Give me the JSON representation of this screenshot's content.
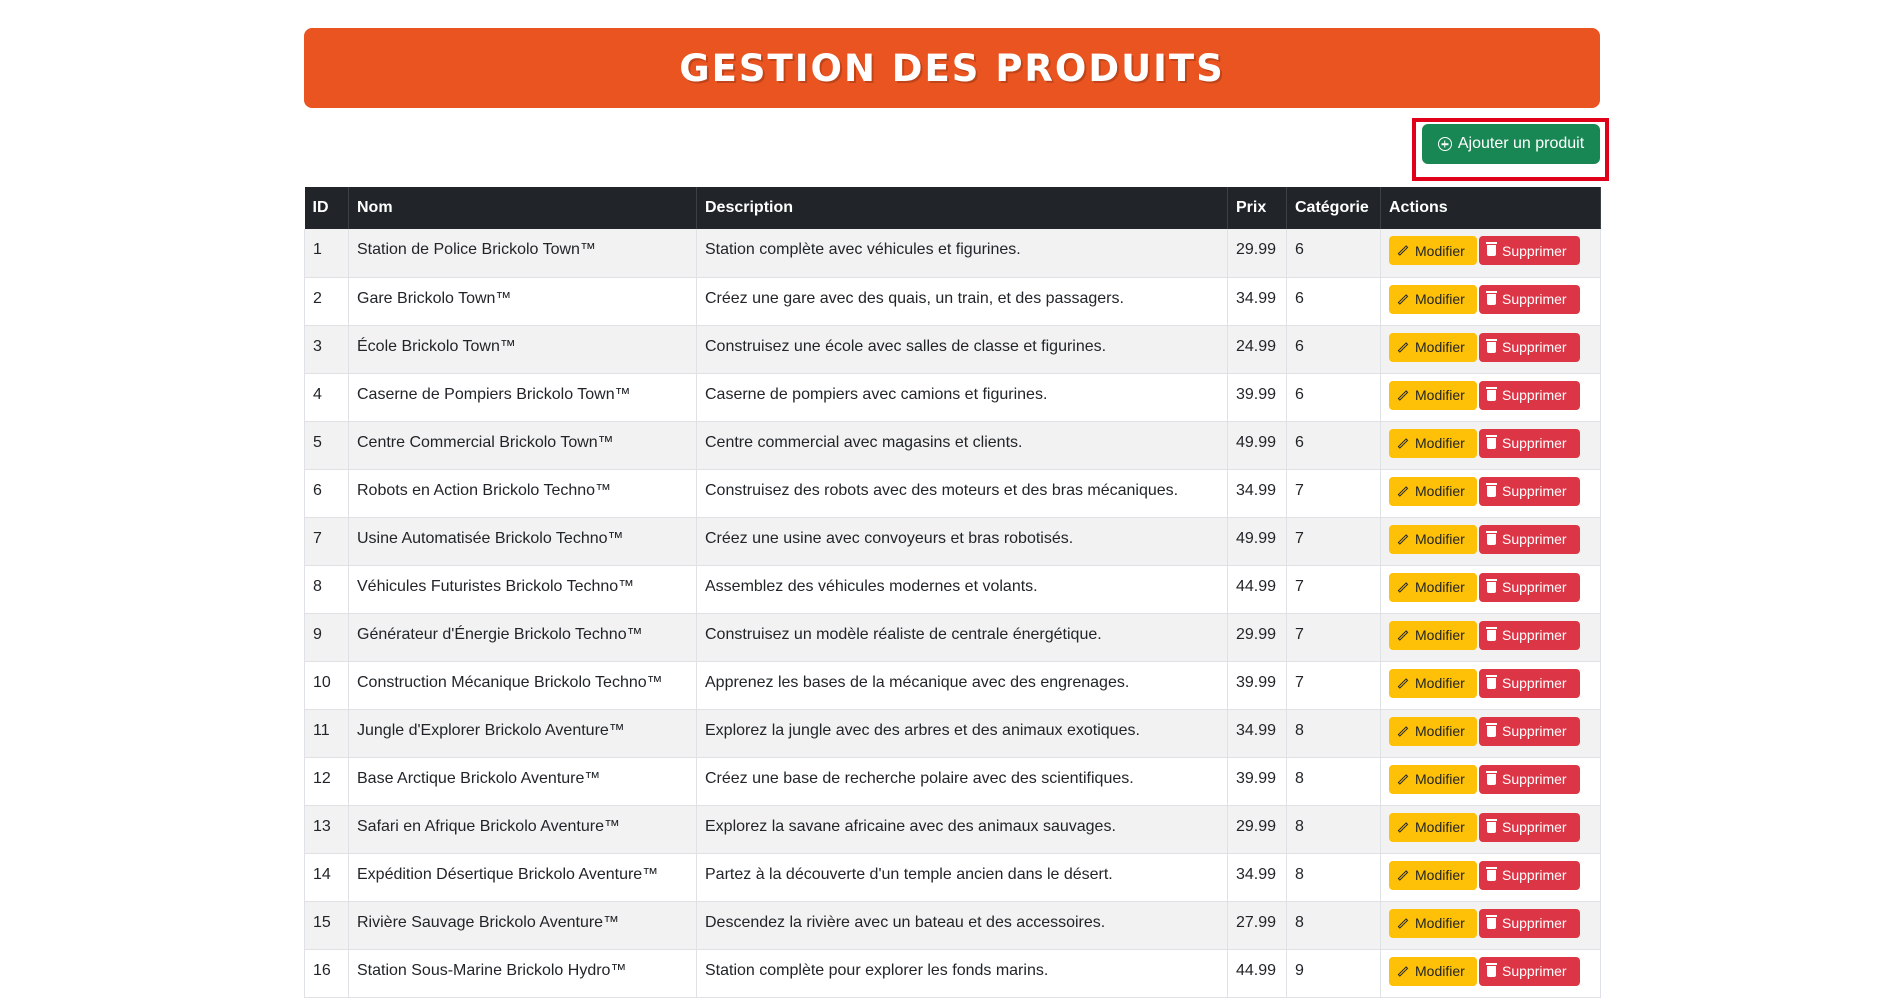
{
  "header": {
    "title": "GESTION DES PRODUITS"
  },
  "toolbar": {
    "add_label": "Ajouter un produit",
    "add_icon": "plus-circle-icon"
  },
  "table": {
    "columns": [
      "ID",
      "Nom",
      "Description",
      "Prix",
      "Catégorie",
      "Actions"
    ],
    "edit_label": "Modifier",
    "delete_label": "Supprimer",
    "rows": [
      {
        "id": "1",
        "nom": "Station de Police Brickolo Town™",
        "description": "Station complète avec véhicules et figurines.",
        "prix": "29.99",
        "categorie": "6"
      },
      {
        "id": "2",
        "nom": "Gare Brickolo Town™",
        "description": "Créez une gare avec des quais, un train, et des passagers.",
        "prix": "34.99",
        "categorie": "6"
      },
      {
        "id": "3",
        "nom": "École Brickolo Town™",
        "description": "Construisez une école avec salles de classe et figurines.",
        "prix": "24.99",
        "categorie": "6"
      },
      {
        "id": "4",
        "nom": "Caserne de Pompiers Brickolo Town™",
        "description": "Caserne de pompiers avec camions et figurines.",
        "prix": "39.99",
        "categorie": "6"
      },
      {
        "id": "5",
        "nom": "Centre Commercial Brickolo Town™",
        "description": "Centre commercial avec magasins et clients.",
        "prix": "49.99",
        "categorie": "6"
      },
      {
        "id": "6",
        "nom": "Robots en Action Brickolo Techno™",
        "description": "Construisez des robots avec des moteurs et des bras mécaniques.",
        "prix": "34.99",
        "categorie": "7"
      },
      {
        "id": "7",
        "nom": "Usine Automatisée Brickolo Techno™",
        "description": "Créez une usine avec convoyeurs et bras robotisés.",
        "prix": "49.99",
        "categorie": "7"
      },
      {
        "id": "8",
        "nom": "Véhicules Futuristes Brickolo Techno™",
        "description": "Assemblez des véhicules modernes et volants.",
        "prix": "44.99",
        "categorie": "7"
      },
      {
        "id": "9",
        "nom": "Générateur d'Énergie Brickolo Techno™",
        "description": "Construisez un modèle réaliste de centrale énergétique.",
        "prix": "29.99",
        "categorie": "7"
      },
      {
        "id": "10",
        "nom": "Construction Mécanique Brickolo Techno™",
        "description": "Apprenez les bases de la mécanique avec des engrenages.",
        "prix": "39.99",
        "categorie": "7"
      },
      {
        "id": "11",
        "nom": "Jungle d'Explorer Brickolo Aventure™",
        "description": "Explorez la jungle avec des arbres et des animaux exotiques.",
        "prix": "34.99",
        "categorie": "8"
      },
      {
        "id": "12",
        "nom": "Base Arctique Brickolo Aventure™",
        "description": "Créez une base de recherche polaire avec des scientifiques.",
        "prix": "39.99",
        "categorie": "8"
      },
      {
        "id": "13",
        "nom": "Safari en Afrique Brickolo Aventure™",
        "description": "Explorez la savane africaine avec des animaux sauvages.",
        "prix": "29.99",
        "categorie": "8"
      },
      {
        "id": "14",
        "nom": "Expédition Désertique Brickolo Aventure™",
        "description": "Partez à la découverte d'un temple ancien dans le désert.",
        "prix": "34.99",
        "categorie": "8"
      },
      {
        "id": "15",
        "nom": "Rivière Sauvage Brickolo Aventure™",
        "description": "Descendez la rivière avec un bateau et des accessoires.",
        "prix": "27.99",
        "categorie": "8"
      },
      {
        "id": "16",
        "nom": "Station Sous-Marine Brickolo Hydro™",
        "description": "Station complète pour explorer les fonds marins.",
        "prix": "44.99",
        "categorie": "9"
      }
    ]
  },
  "colors": {
    "banner": "#e95420",
    "add_button": "#198754",
    "edit_button": "#ffc107",
    "delete_button": "#dc3545",
    "header_row": "#212529"
  }
}
